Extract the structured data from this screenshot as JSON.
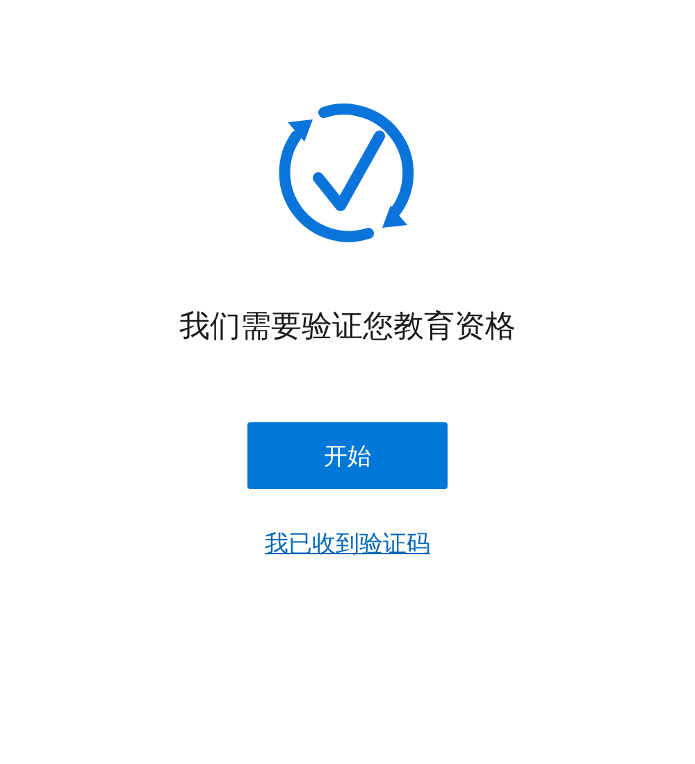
{
  "heading": "我们需要验证您教育资格",
  "start_button": "开始",
  "code_link": "我已收到验证码"
}
